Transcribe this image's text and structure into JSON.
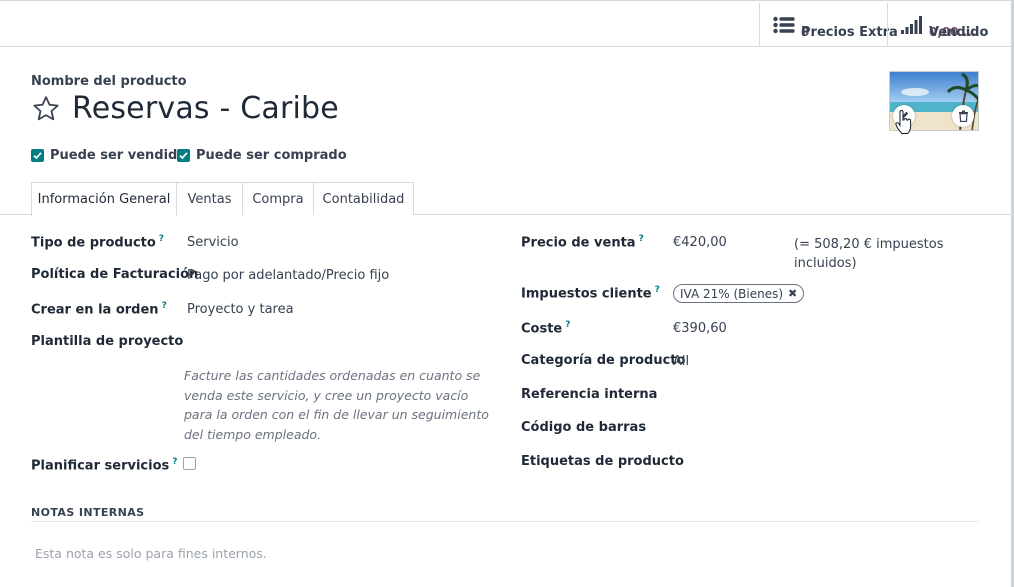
{
  "stats": {
    "extra_value": "0",
    "extra_label": "Precios Extra",
    "sold_value": "0,00 ...",
    "sold_label": "Vendido"
  },
  "product": {
    "name_label": "Nombre del producto",
    "name": "Reservas - Caribe"
  },
  "checks": {
    "can_sell": "Puede ser vendido",
    "can_buy": "Puede ser comprado"
  },
  "tabs": [
    "Información General",
    "Ventas",
    "Compra",
    "Contabilidad"
  ],
  "general": {
    "type_label": "Tipo de producto",
    "type_value": "Servicio",
    "invoicing_label": "Política de Facturación",
    "invoicing_value": "Pago por adelantado/Precio fijo",
    "create_label": "Crear en la orden",
    "create_value": "Proyecto y tarea",
    "template_label": "Plantilla de proyecto",
    "help_text": "Facture las cantidades ordenadas en cuanto se venda este servicio, y cree un proyecto vacío para la orden con el fin de llevar un seguimiento del tiempo empleado.",
    "plan_label": "Planificar servicios"
  },
  "pricing": {
    "sale_price_label": "Precio de venta",
    "sale_price": "€420,00",
    "tax_included": "(= 508,20 € impuestos incluidos)",
    "taxes_label": "Impuestos cliente",
    "tax_tag": "IVA 21% (Bienes)",
    "cost_label": "Coste",
    "cost": "€390,60",
    "category_label": "Categoría de producto",
    "category": "All",
    "ref_label": "Referencia interna",
    "barcode_label": "Código de barras",
    "tags_label": "Etiquetas de producto"
  },
  "notes": {
    "title": "NOTAS INTERNAS",
    "placeholder": "Esta nota es solo para fines internos."
  },
  "colors": {
    "accent": "#017e84",
    "brand": "#714b67"
  }
}
